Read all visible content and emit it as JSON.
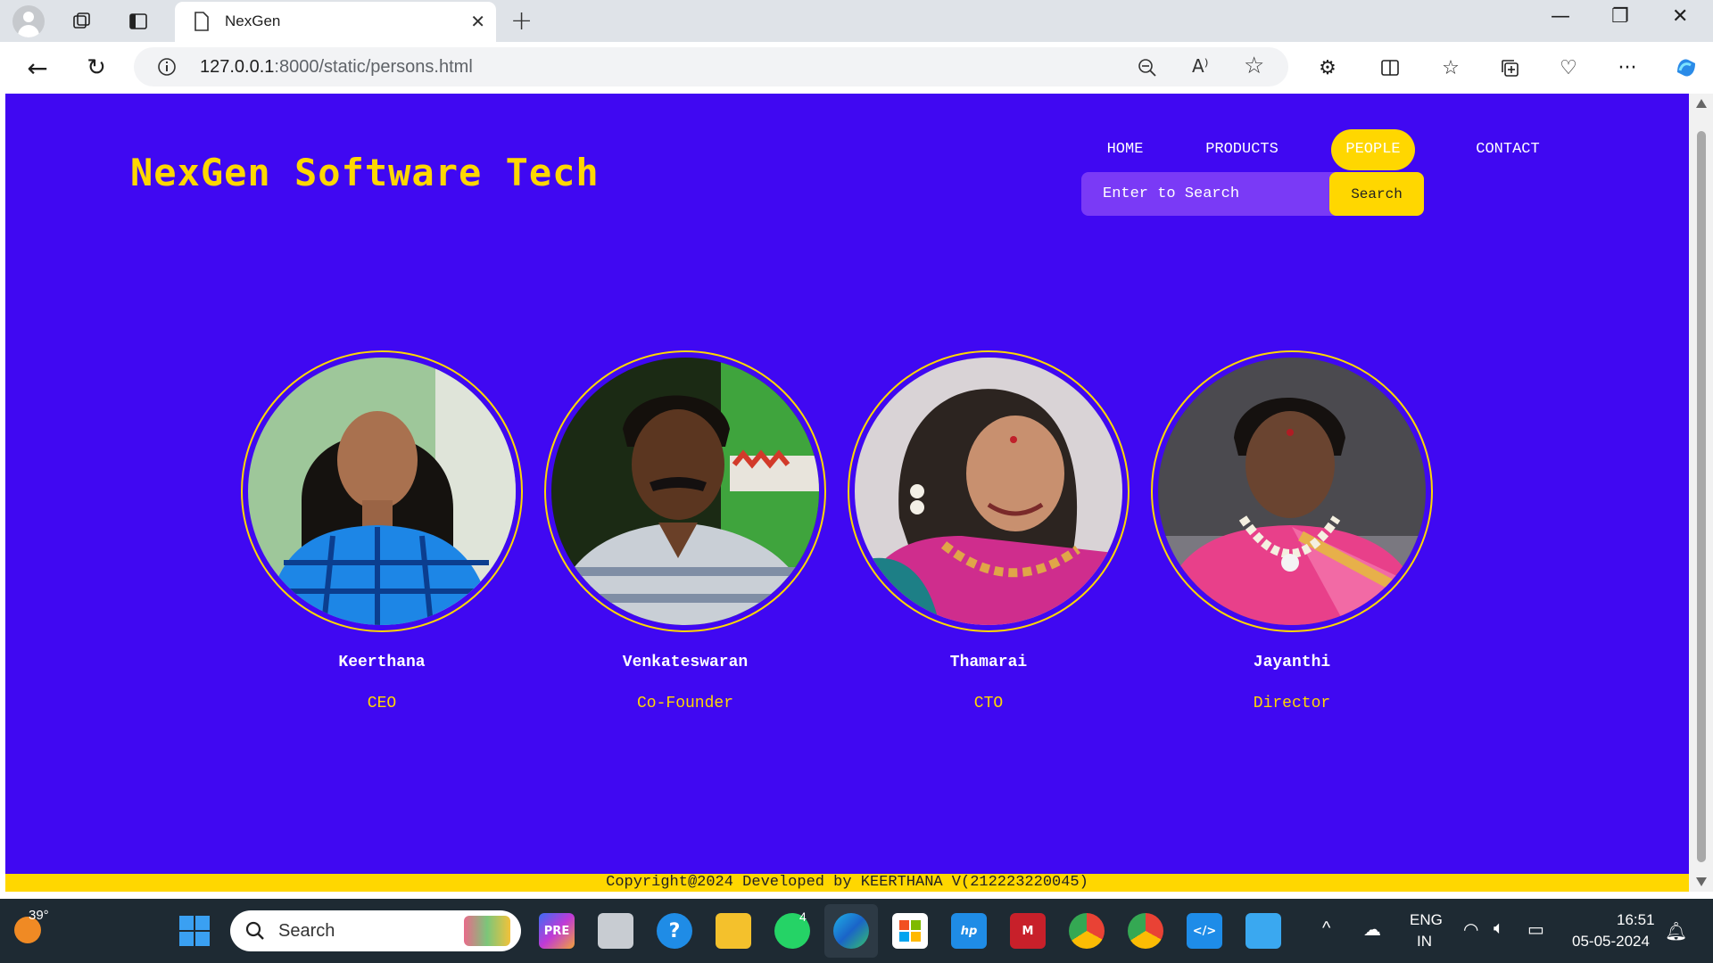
{
  "browser": {
    "tab_title": "NexGen",
    "url_host": "127.0.0.1",
    "url_rest": ":8000/static/persons.html"
  },
  "site": {
    "title": "NexGen Software Tech",
    "nav": [
      {
        "label": "HOME",
        "active": false
      },
      {
        "label": "PRODUCTS",
        "active": false
      },
      {
        "label": "PEOPLE",
        "active": true
      },
      {
        "label": "CONTACT",
        "active": false
      }
    ],
    "search": {
      "placeholder": "Enter to Search",
      "button": "Search"
    },
    "people": [
      {
        "name": "Keerthana",
        "role": "CEO"
      },
      {
        "name": "Venkateswaran",
        "role": "Co-Founder"
      },
      {
        "name": "Thamarai",
        "role": "CTO"
      },
      {
        "name": "Jayanthi",
        "role": "Director"
      }
    ],
    "footer": "Copyright@2024 Developed by KEERTHANA V(212223220045)"
  },
  "colors": {
    "page_bg": "#4008f2",
    "accent": "#ffd700"
  },
  "taskbar": {
    "weather": "39°",
    "search_label": "Search",
    "whatsapp_badge": "4",
    "lang_1": "ENG",
    "lang_2": "IN",
    "time": "16:51",
    "date": "05-05-2024"
  }
}
